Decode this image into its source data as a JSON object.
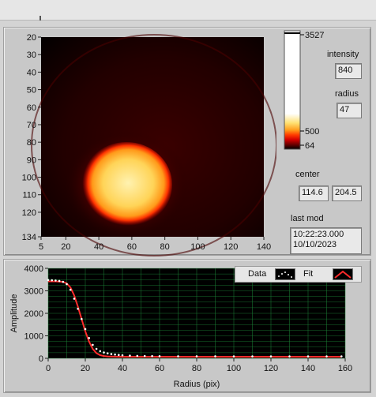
{
  "image_panel": {
    "y_ticks": [
      "20",
      "30",
      "40",
      "50",
      "60",
      "70",
      "80",
      "90",
      "100",
      "110",
      "120",
      "134"
    ],
    "x_ticks": [
      "5",
      "20",
      "40",
      "60",
      "80",
      "100",
      "120",
      "140"
    ],
    "colormap_colors": [
      "#000000",
      "#6b0000",
      "#d40000",
      "#ff3b00",
      "#ff9a1a",
      "#ffe070",
      "#ffffff"
    ]
  },
  "colorbar": {
    "max_label": "3527",
    "mid_label": "500",
    "min_label": "64"
  },
  "intensity": {
    "label": "intensity",
    "value": "840"
  },
  "radius": {
    "label": "radius",
    "value": "47"
  },
  "center": {
    "label": "center",
    "x": "114.6",
    "y": "204.5"
  },
  "last_mod": {
    "label": "last mod",
    "time": "10:22:23.000",
    "date": "10/10/2023"
  },
  "legend": {
    "data_label": "Data",
    "fit_label": "Fit"
  },
  "chart_data": {
    "type": "scatter",
    "xlabel": "Radius (pix)",
    "ylabel": "Amplitude",
    "xlim": [
      0,
      160
    ],
    "ylim": [
      0,
      4000
    ],
    "x_ticks": [
      0,
      20,
      40,
      60,
      80,
      100,
      120,
      140,
      160
    ],
    "y_ticks": [
      0,
      1000,
      2000,
      3000,
      4000
    ],
    "grid": true,
    "legend_position": "top-right",
    "background": "#000000",
    "grid_color": "#1e8a3a",
    "series": [
      {
        "name": "Data",
        "color": "#ffffff",
        "x": [
          0,
          2,
          4,
          6,
          8,
          10,
          12,
          14,
          16,
          18,
          20,
          22,
          24,
          26,
          28,
          30,
          32,
          34,
          36,
          38,
          40,
          44,
          48,
          52,
          56,
          60,
          70,
          80,
          90,
          100,
          110,
          120,
          130,
          140,
          150,
          158
        ],
        "y": [
          3480,
          3470,
          3460,
          3440,
          3400,
          3300,
          3050,
          2650,
          2200,
          1750,
          1300,
          900,
          600,
          420,
          320,
          260,
          220,
          190,
          170,
          150,
          135,
          120,
          110,
          105,
          100,
          95,
          92,
          90,
          90,
          88,
          88,
          87,
          87,
          86,
          86,
          86
        ]
      },
      {
        "name": "Fit",
        "color": "#ff2b2b",
        "x": [
          0,
          4,
          8,
          10,
          12,
          14,
          16,
          18,
          20,
          22,
          24,
          26,
          28,
          30,
          32,
          34,
          36,
          40,
          50,
          60,
          80,
          100,
          120,
          140,
          158
        ],
        "y": [
          3420,
          3420,
          3400,
          3330,
          3150,
          2800,
          2300,
          1750,
          1200,
          750,
          420,
          230,
          140,
          100,
          85,
          80,
          75,
          70,
          68,
          68,
          68,
          68,
          68,
          68,
          68
        ]
      }
    ]
  }
}
